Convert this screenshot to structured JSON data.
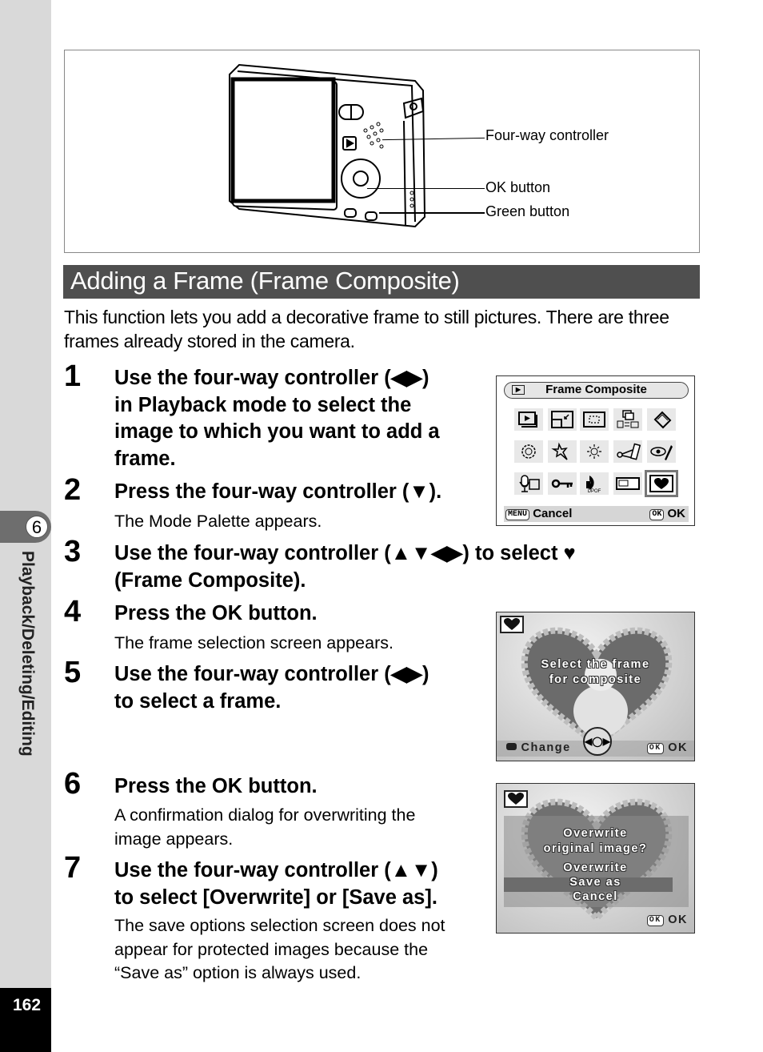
{
  "sidebar": {
    "chapter_number": "6",
    "chapter_title": "Playback/Deleting/Editing",
    "page_number": "162"
  },
  "figure": {
    "callouts": [
      "Four-way controller",
      "OK button",
      "Green button"
    ]
  },
  "section": {
    "heading": "Adding a Frame (Frame Composite)",
    "intro": "This function lets you add a decorative frame to still pictures. There are three frames already stored in the camera."
  },
  "steps": [
    {
      "num": "1",
      "title_lines": [
        "Use the four-way controller (◀▶)",
        "in Playback mode to select the",
        "image to which you want to add a",
        "frame."
      ],
      "desc_lines": []
    },
    {
      "num": "2",
      "title_lines": [
        "Press the four-way controller (▼)."
      ],
      "desc_lines": [
        "The Mode Palette appears."
      ]
    },
    {
      "num": "3",
      "title_lines": [
        "Use the four-way controller (▲▼◀▶) to select ♥",
        "(Frame Composite)."
      ],
      "desc_lines": []
    },
    {
      "num": "4",
      "title_lines": [
        "Press the OK button."
      ],
      "desc_lines": [
        "The frame selection screen appears."
      ]
    },
    {
      "num": "5",
      "title_lines": [
        "Use the four-way controller (◀▶)",
        "to select a frame."
      ],
      "desc_lines": []
    },
    {
      "num": "6",
      "title_lines": [
        "Press the OK button."
      ],
      "desc_lines": [
        "A confirmation dialog for overwriting the",
        "image appears."
      ]
    },
    {
      "num": "7",
      "title_lines": [
        "Use the four-way controller (▲▼)",
        "to select [Overwrite] or [Save as]."
      ],
      "desc_lines": [
        "The save options selection screen does not",
        "appear for protected images because the",
        "“Save as” option is always used."
      ]
    }
  ],
  "screens": {
    "palette": {
      "title": "Frame Composite",
      "icons": [
        "playback-icon",
        "resize-icon",
        "trimming-icon",
        "image-copy-icon",
        "rotate-icon",
        "digital-filter-icon",
        "brightness-filter-icon",
        "red-eye-icon",
        "movie-edit-icon",
        "red-eye-edit-icon",
        "voice-memo-icon",
        "protect-icon",
        "dpof-icon",
        "start-up-screen-icon",
        "frame-composite-icon"
      ],
      "selected_index": 14,
      "dpof_label": "DPOF",
      "menu_key": "MENU",
      "cancel_label": "Cancel",
      "ok_key": "OK",
      "ok_label": "OK"
    },
    "frame_select": {
      "message_lines": [
        "Select the frame",
        "for composite"
      ],
      "change_label": "Change",
      "ok_key": "OK",
      "ok_label": "OK"
    },
    "confirm": {
      "question_lines": [
        "Overwrite",
        "original image?"
      ],
      "options": [
        "Overwrite",
        "Save as",
        "Cancel"
      ],
      "selected_option": "Save as",
      "ok_key": "OK",
      "ok_label": "OK"
    }
  }
}
